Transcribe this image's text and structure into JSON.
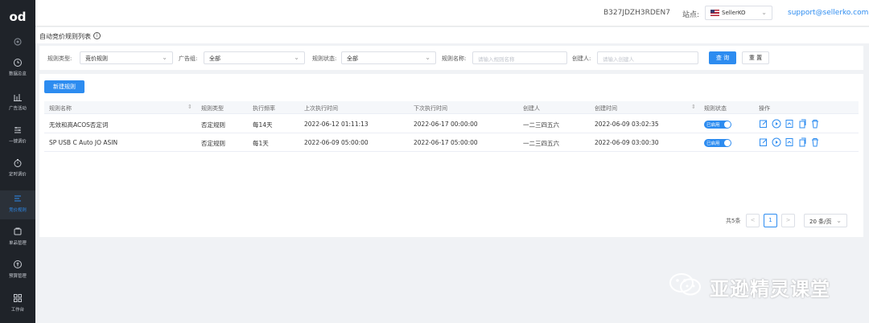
{
  "app": {
    "logo_text": "od"
  },
  "sidebar": {
    "items": [
      {
        "label": "数据总览",
        "icon": "clock-icon"
      },
      {
        "label": "广告活动",
        "icon": "chart-icon"
      },
      {
        "label": "一键调价",
        "icon": "sliders-icon"
      },
      {
        "label": "定时调价",
        "icon": "timer-icon"
      },
      {
        "label": "竞价规则",
        "icon": "rules-icon",
        "active": true
      },
      {
        "label": "单品管理",
        "icon": "bag-icon"
      },
      {
        "label": "预算管理",
        "icon": "budget-icon"
      },
      {
        "label": "工作台",
        "icon": "grid-icon"
      }
    ]
  },
  "header": {
    "store_id": "B327JDZH3RDEN7",
    "site_label": "站点:",
    "site_value": "SellerKO",
    "email": "support@sellerko.com"
  },
  "page": {
    "title": "自动竞价规则列表"
  },
  "filters": {
    "rule_type_label": "规则类型:",
    "rule_type_value": "竞价规则",
    "ad_group_label": "广告组:",
    "ad_group_value": "全部",
    "rule_status_label": "规则状态:",
    "rule_status_value": "全部",
    "rule_name_label": "规则名称:",
    "rule_name_placeholder": "请输入规则名称",
    "creator_label": "创建人:",
    "creator_placeholder": "请输入创建人",
    "query_button": "查 询",
    "reset_button": "重 置"
  },
  "table": {
    "new_rule_button": "新建规则",
    "columns": [
      "规则名称",
      "规则类型",
      "执行频率",
      "上次执行时间",
      "下次执行时间",
      "创建人",
      "创建时间",
      "规则状态",
      "操作"
    ],
    "rows": [
      {
        "name": "无效和高ACOS否定词",
        "type": "否定规则",
        "freq": "每14天",
        "last_run": "2022-06-12 01:11:13",
        "next_run": "2022-06-17 00:00:00",
        "creator": "一二三四五六",
        "created": "2022-06-09 03:02:35",
        "status": "已启用"
      },
      {
        "name": "SP USB C Auto JO ASIN",
        "type": "否定规则",
        "freq": "每1天",
        "last_run": "2022-06-09 05:00:00",
        "next_run": "2022-06-17 05:00:00",
        "creator": "一二三四五六",
        "created": "2022-06-09 03:00:30",
        "status": "已启用"
      }
    ]
  },
  "pagination": {
    "total": "共5条",
    "prev": "<",
    "current_page": "1",
    "next": ">",
    "page_size": "20 条/页"
  },
  "watermark": {
    "text": "亚逊精灵课堂"
  },
  "colors": {
    "accent": "#2d8cf0",
    "sidebar_bg": "#1f2329"
  }
}
